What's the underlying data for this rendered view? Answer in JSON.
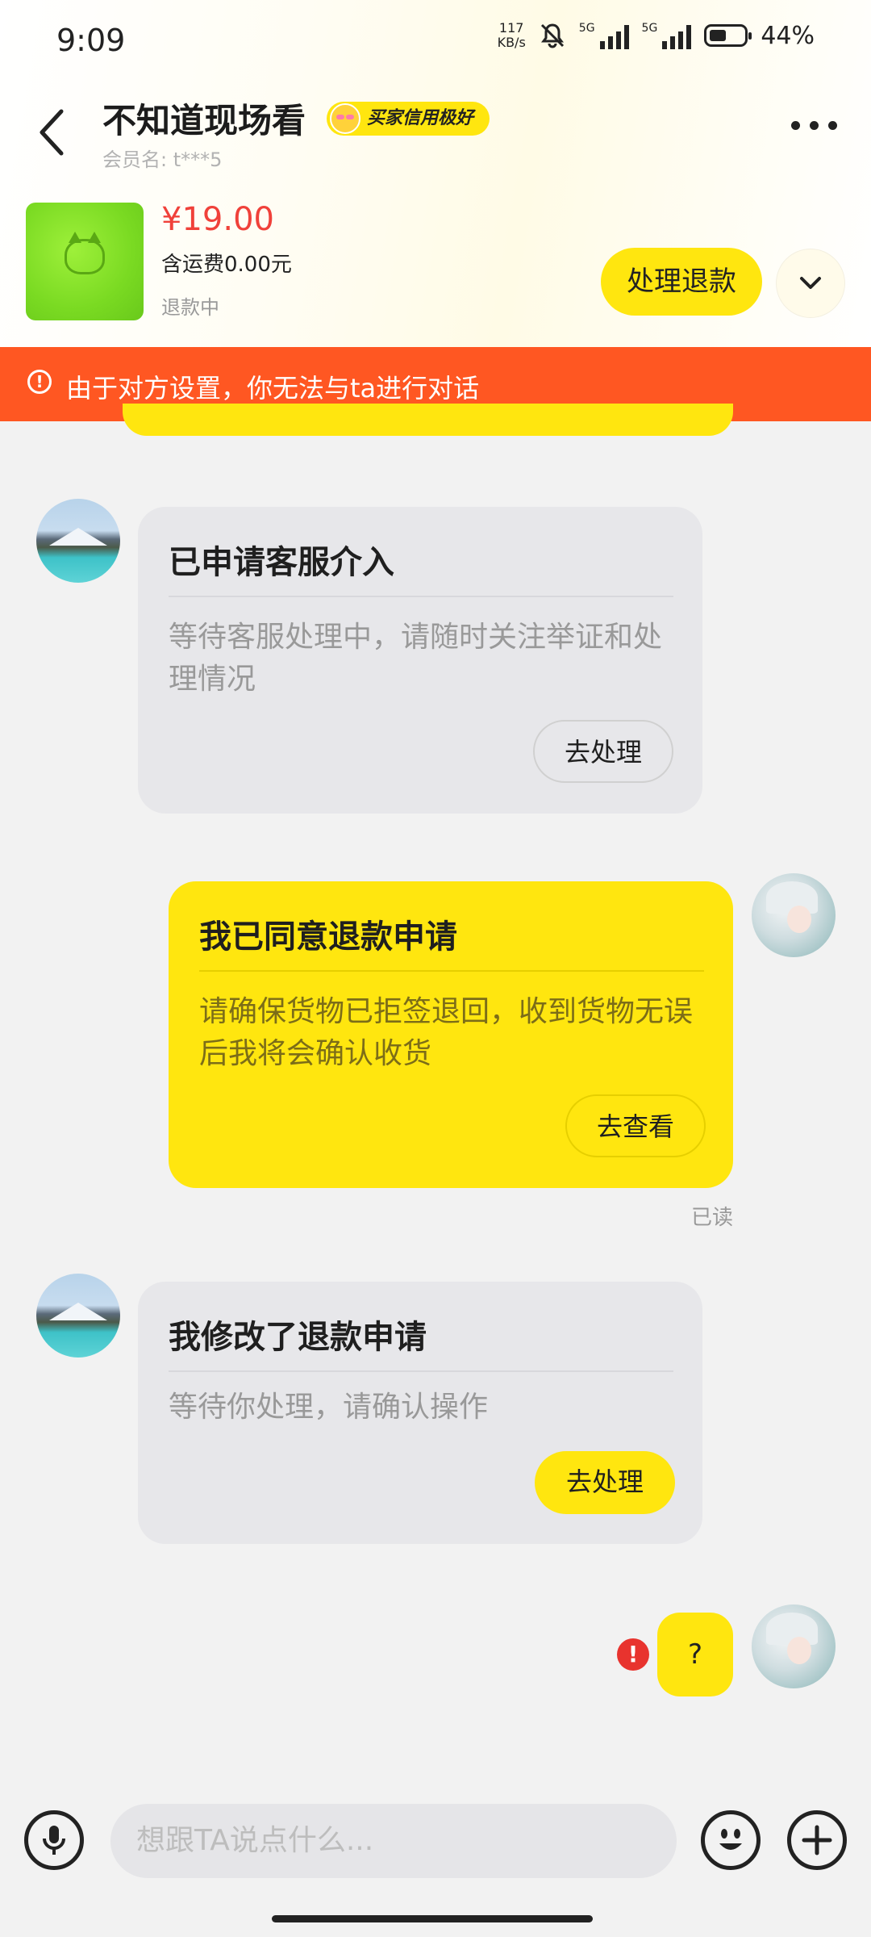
{
  "status_bar": {
    "time": "9:09",
    "net_speed_value": "117",
    "net_speed_unit": "KB/s",
    "sim1": "5G",
    "sim2": "5G",
    "battery": "44%"
  },
  "header": {
    "title": "不知道现场看",
    "badge": "买家信用极好",
    "subtitle": "会员名: t***5"
  },
  "product": {
    "price": "¥19.00",
    "shipping": "含运费0.00元",
    "status": "退款中",
    "action_label": "处理退款"
  },
  "warning": {
    "text": "由于对方设置，你无法与ta进行对话"
  },
  "messages": [
    {
      "side": "left",
      "title": "已申请客服介入",
      "body": "等待客服处理中，请随时关注举证和处理情况",
      "button": "去处理"
    },
    {
      "side": "right",
      "title": "我已同意退款申请",
      "body": "请确保货物已拒签退回，收到货物无误后我将会确认收货",
      "button": "去查看",
      "receipt": "已读"
    },
    {
      "side": "left",
      "title": "我修改了退款申请",
      "body": "等待你处理，请确认操作",
      "button": "去处理"
    },
    {
      "side": "right",
      "text": "?",
      "failed": true
    }
  ],
  "composer": {
    "placeholder": "想跟TA说点什么..."
  },
  "colors": {
    "accent_yellow": "#ffe60f",
    "warning_orange": "#ff5722",
    "price_red": "#f0413a",
    "error_red": "#e8332e"
  }
}
